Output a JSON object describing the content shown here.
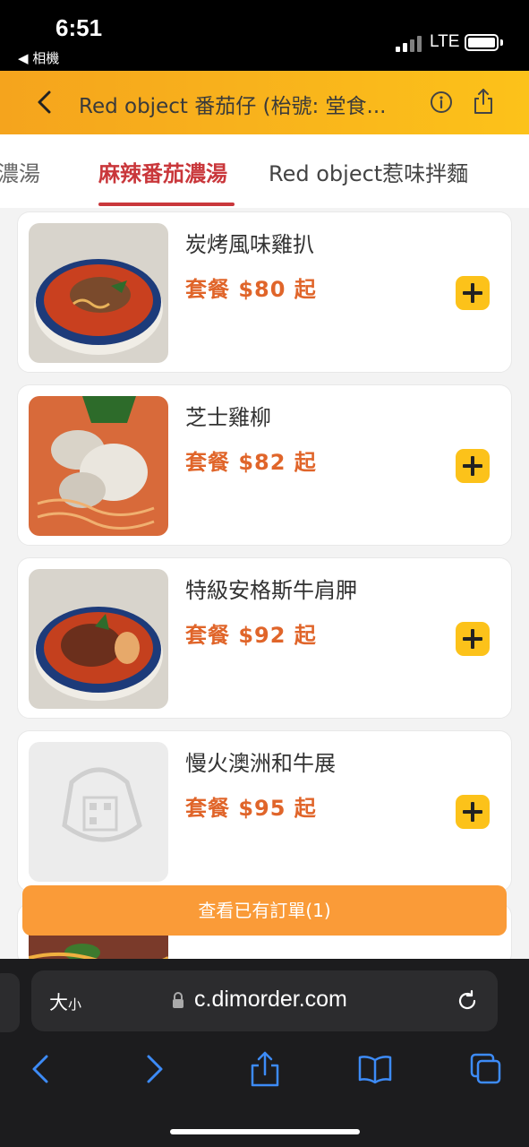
{
  "status": {
    "time": "6:51",
    "back_app": "◀ 相機",
    "network": "LTE"
  },
  "header": {
    "title": "Red object 番茄仔 (枱號: 堂食..."
  },
  "tabs": [
    {
      "label": "濃湯"
    },
    {
      "label": "麻辣番茄濃湯"
    },
    {
      "label": "Red object惹味拌麵"
    }
  ],
  "items": [
    {
      "name": "炭烤風味雞扒",
      "price": "套餐 $80 起"
    },
    {
      "name": "芝士雞柳",
      "price": "套餐 $82 起"
    },
    {
      "name": "特級安格斯牛肩胛",
      "price": "套餐 $92 起"
    },
    {
      "name": "慢火澳洲和牛展",
      "price": "套餐 $95 起"
    }
  ],
  "orders_bar": {
    "label": "查看已有訂單(1)"
  },
  "browser": {
    "text_size_big": "大",
    "text_size_small": "小",
    "url": "c.dimorder.com"
  },
  "colors": {
    "accent": "#fcc21a",
    "header_gradient_start": "#f5a41d",
    "active_tab": "#c9373b",
    "price": "#e0652a",
    "orders_bar": "#fa9b38",
    "browser_icon": "#3d8bf7"
  }
}
